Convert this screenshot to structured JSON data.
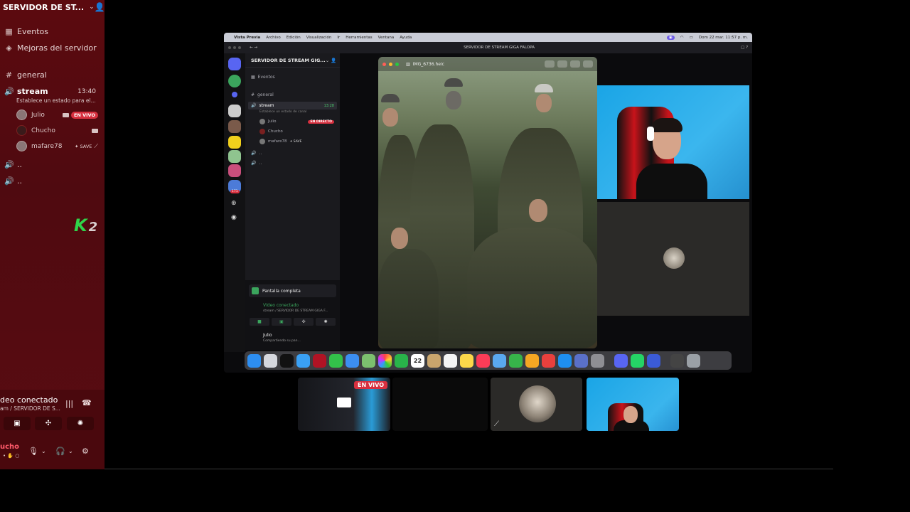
{
  "server": {
    "name": "SERVIDOR DE ST...",
    "menu": [
      "Eventos",
      "Mejoras del servidor"
    ],
    "text_channel": "general",
    "voice_channel": {
      "name": "stream",
      "time": "13:40",
      "status": "Establece un estado para el...",
      "users": [
        {
          "name": "Julio",
          "badge": "EN VIVO"
        },
        {
          "name": "Chucho",
          "badge": ""
        },
        {
          "name": "mafare78",
          "badge": "SAVE"
        }
      ]
    },
    "extra_channels": [
      "..",
      ".."
    ]
  },
  "overlay_logo": {
    "k": "K",
    "n": "2"
  },
  "voice_panel": {
    "title": "deo conectado",
    "subtitle": "am / SERVIDOR DE S...",
    "user": "ucho"
  },
  "shared_screen": {
    "menubar": [
      "Vista Previa",
      "Archivo",
      "Edición",
      "Visualización",
      "Ir",
      "Herramientas",
      "Ventana",
      "Ayuda"
    ],
    "clock": "Dom 22 mar. 11:57 p. m.",
    "window_title": "SERVIDOR DE STREAM GIGA FALOPA",
    "inner": {
      "server_name": "SERVIDOR DE STREAM GIG...",
      "events": "Eventos",
      "general": "general",
      "stream": "stream",
      "stream_time": "13:28",
      "stream_status": "Establece un estado de canal",
      "users": [
        {
          "name": "Julio",
          "badge": "EN DIRECTO"
        },
        {
          "name": "Chucho",
          "badge": ""
        },
        {
          "name": "mafare78",
          "badge": "SAVE"
        }
      ],
      "extra": [
        "..",
        ".."
      ],
      "fullscreen": "Pantalla completa",
      "connected": "Vídeo conectado",
      "connected_sub": "stream / SERVIDOR DE STREAM GIGA F...",
      "self_name": "Julio",
      "self_sub": "Compartiendo su pan..."
    },
    "photo_title": "IMG_6736.heic",
    "calendar_day": "22",
    "badge_count": "171"
  },
  "tiles": {
    "live_badge": "EN VIVO"
  }
}
